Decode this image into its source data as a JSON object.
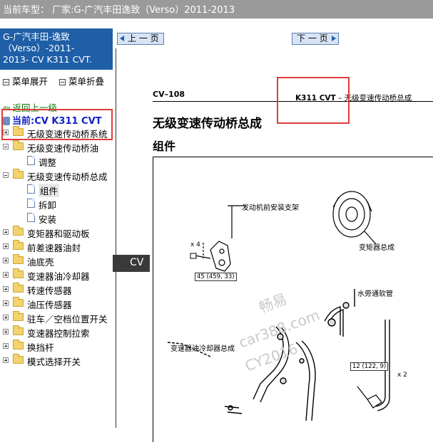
{
  "topbar": {
    "title": "当前车型：  厂家:G-广汽丰田逸致（Verso）2011-2013"
  },
  "sidebar": {
    "title_line1": "G-广汽丰田-逸致",
    "title_line2": "（Verso）-2011-",
    "title_line3": "2013- CV K311 CVT.",
    "expand_label": "菜单展开",
    "collapse_label": "菜单折叠",
    "back_label": "返回上一级",
    "current_label": "当前:CV K311 CVT",
    "tree": [
      {
        "label": "无级变速传动桥系统",
        "type": "folder",
        "level": 0,
        "expanded": false
      },
      {
        "label": "无级变速传动桥油",
        "type": "folder",
        "level": 0,
        "expanded": true
      },
      {
        "label": "调整",
        "type": "doc",
        "level": 1
      },
      {
        "label": "无级变速传动桥总成",
        "type": "folder",
        "level": 0,
        "expanded": true
      },
      {
        "label": "组件",
        "type": "doc",
        "level": 1,
        "selected": true
      },
      {
        "label": "拆卸",
        "type": "doc",
        "level": 1
      },
      {
        "label": "安装",
        "type": "doc",
        "level": 1
      },
      {
        "label": "变矩器和驱动板",
        "type": "folder",
        "level": 0,
        "expanded": false
      },
      {
        "label": "前差速器油封",
        "type": "folder",
        "level": 0,
        "expanded": false
      },
      {
        "label": "油底壳",
        "type": "folder",
        "level": 0,
        "expanded": false
      },
      {
        "label": "变速器油冷却器",
        "type": "folder",
        "level": 0,
        "expanded": false
      },
      {
        "label": "转速传感器",
        "type": "folder",
        "level": 0,
        "expanded": false
      },
      {
        "label": "油压传感器",
        "type": "folder",
        "level": 0,
        "expanded": false
      },
      {
        "label": "驻车／空档位置开关",
        "type": "folder",
        "level": 0,
        "expanded": false
      },
      {
        "label": "变速器控制拉索",
        "type": "folder",
        "level": 0,
        "expanded": false
      },
      {
        "label": "换挡杆",
        "type": "folder",
        "level": 0,
        "expanded": false
      },
      {
        "label": "模式选择开关",
        "type": "folder",
        "level": 0,
        "expanded": false
      }
    ]
  },
  "nav": {
    "prev_label": "上 一 页",
    "next_label": "下 一 页"
  },
  "side_tab": {
    "label": "CV"
  },
  "document": {
    "page_ref": "CV–108",
    "header_model": "K311 CVT",
    "header_sep": "–",
    "header_title": "无级变速传动桥总成",
    "title": "无级变速传动桥总成",
    "subtitle": "组件",
    "labels": {
      "engine_mount": "发动机前安装支架",
      "torque_converter": "变矩器总成",
      "water_hose": "水旁通软管",
      "cooler_pipe": "变速器油冷却器总成",
      "qty_x4": "x 4",
      "qty_x2": "x 2",
      "torque_45": "45 (459, 33)",
      "torque_12": "12 (122, 9)"
    }
  },
  "watermark": {
    "line1": "畅易",
    "line2": "car388.com",
    "line3": "CY2016"
  },
  "colors": {
    "sidebar_header": "#1f5fa8",
    "annotation": "#e03a3a",
    "topbar": "#9a9a9a",
    "current_text": "#1020c8"
  }
}
